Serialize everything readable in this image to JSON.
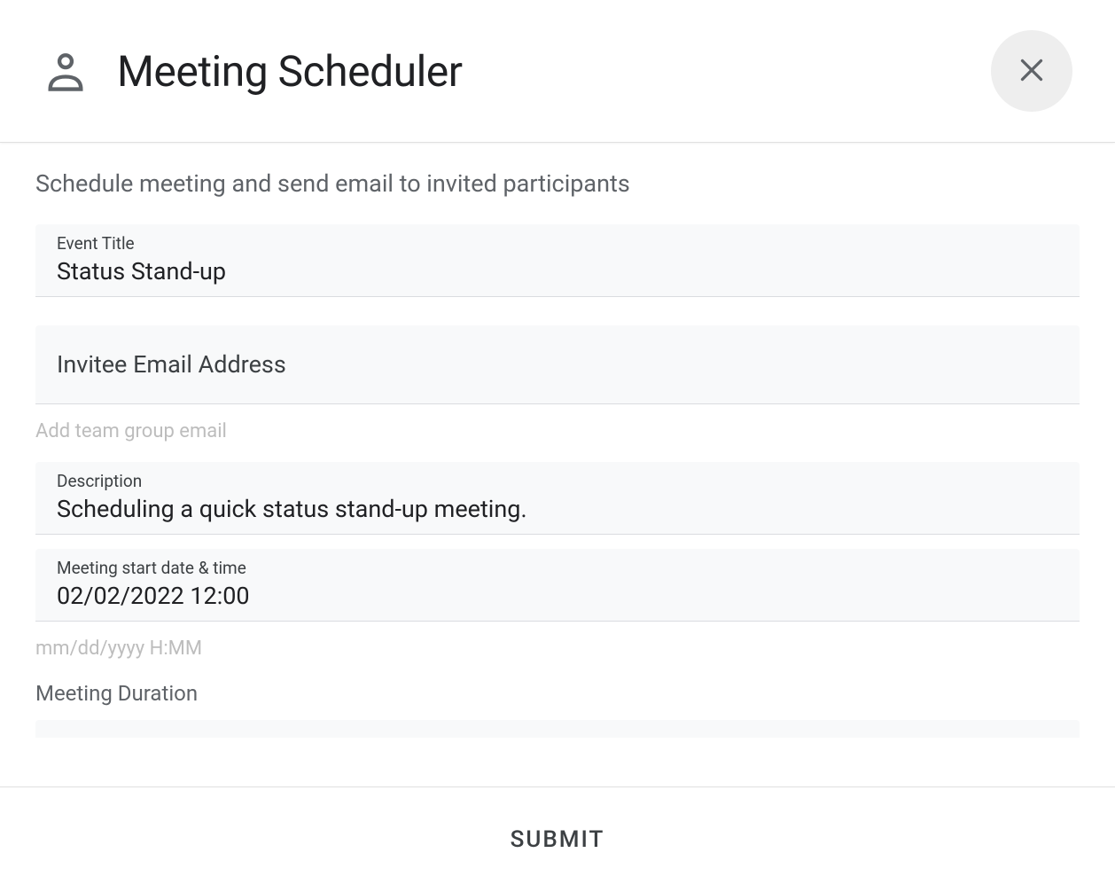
{
  "header": {
    "title": "Meeting Scheduler"
  },
  "form": {
    "subtitle": "Schedule meeting and send email to invited participants",
    "event_title": {
      "label": "Event Title",
      "value": "Status Stand-up"
    },
    "invitee_email": {
      "label": "Invitee Email Address",
      "value": "",
      "helper": "Add team group email"
    },
    "description": {
      "label": "Description",
      "value": "Scheduling a quick status stand-up meeting."
    },
    "start_datetime": {
      "label": "Meeting start date & time",
      "value": "02/02/2022 12:00",
      "helper": "mm/dd/yyyy H:MM"
    },
    "duration": {
      "label": "Meeting Duration"
    }
  },
  "footer": {
    "submit_label": "SUBMIT"
  }
}
